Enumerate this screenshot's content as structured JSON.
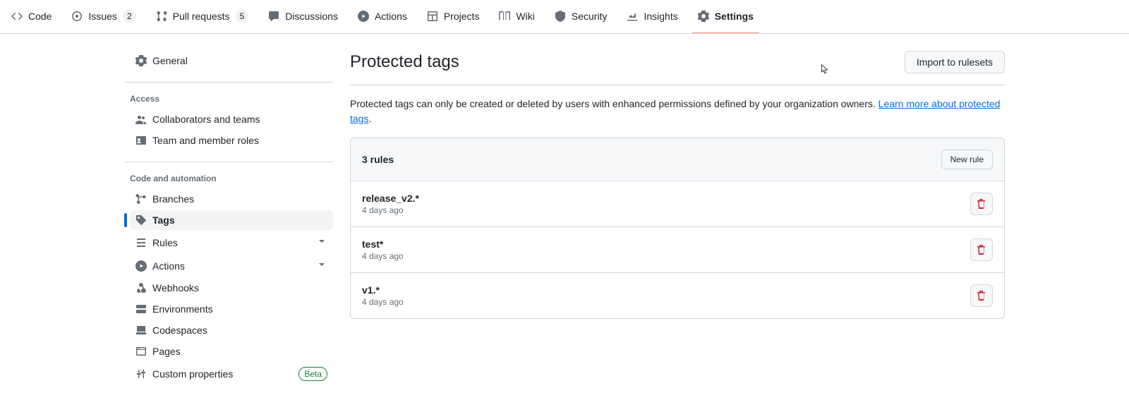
{
  "nav": {
    "code": "Code",
    "issues": "Issues",
    "issues_count": "2",
    "pulls": "Pull requests",
    "pulls_count": "5",
    "discussions": "Discussions",
    "actions": "Actions",
    "projects": "Projects",
    "wiki": "Wiki",
    "security": "Security",
    "insights": "Insights",
    "settings": "Settings"
  },
  "sidebar": {
    "general": "General",
    "access_heading": "Access",
    "collab": "Collaborators and teams",
    "team_roles": "Team and member roles",
    "code_heading": "Code and automation",
    "branches": "Branches",
    "tags": "Tags",
    "rules": "Rules",
    "actions": "Actions",
    "webhooks": "Webhooks",
    "environments": "Environments",
    "codespaces": "Codespaces",
    "pages": "Pages",
    "custom_props": "Custom properties",
    "beta": "Beta"
  },
  "main": {
    "title": "Protected tags",
    "import_btn": "Import to rulesets",
    "desc_prefix": "Protected tags can only be created or deleted by users with enhanced permissions defined by your organization owners. ",
    "desc_link": "Learn more about protected tags",
    "desc_suffix": ".",
    "rules_count": "3 rules",
    "new_rule": "New rule",
    "rules": [
      {
        "name": "release_v2.*",
        "date": "4 days ago"
      },
      {
        "name": "test*",
        "date": "4 days ago"
      },
      {
        "name": "v1.*",
        "date": "4 days ago"
      }
    ]
  }
}
